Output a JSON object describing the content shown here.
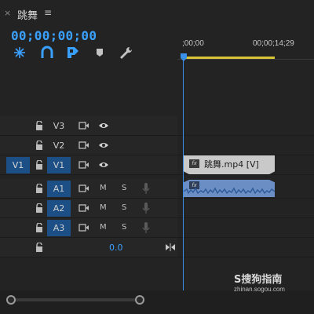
{
  "panel": {
    "close_glyph": "×",
    "title": "跳舞",
    "menu_glyph": "≡"
  },
  "timecode": "00;00;00;00",
  "toolbar": {
    "icons": [
      "snap-icon",
      "linked-selection-icon",
      "add-marker-icon",
      "marker-icon",
      "settings-wrench-icon"
    ]
  },
  "ruler": {
    "start_label": ";00;00",
    "end_label": "00;00;14;29"
  },
  "tracks": {
    "video": [
      {
        "name": "V3",
        "source": "",
        "targeted": false
      },
      {
        "name": "V2",
        "source": "",
        "targeted": false
      },
      {
        "name": "V1",
        "source": "V1",
        "targeted": true
      }
    ],
    "audio": [
      {
        "name": "A1",
        "mute": "M",
        "solo": "S"
      },
      {
        "name": "A2",
        "mute": "M",
        "solo": "S"
      },
      {
        "name": "A3",
        "mute": "M",
        "solo": "S"
      }
    ],
    "master_volume": "0.0"
  },
  "clips": {
    "video_clip_name": "跳舞.mp4 [V]",
    "fx_label": "fx"
  },
  "watermark": {
    "logo": "S搜狗指南",
    "url": "zhinan.sogou.com"
  },
  "colors": {
    "accent_blue": "#3aa0ff",
    "track_selected": "#1c4f86",
    "work_area": "#d8c437",
    "audio_clip": "#6b8fc4",
    "video_clip": "#c9c9c9"
  }
}
